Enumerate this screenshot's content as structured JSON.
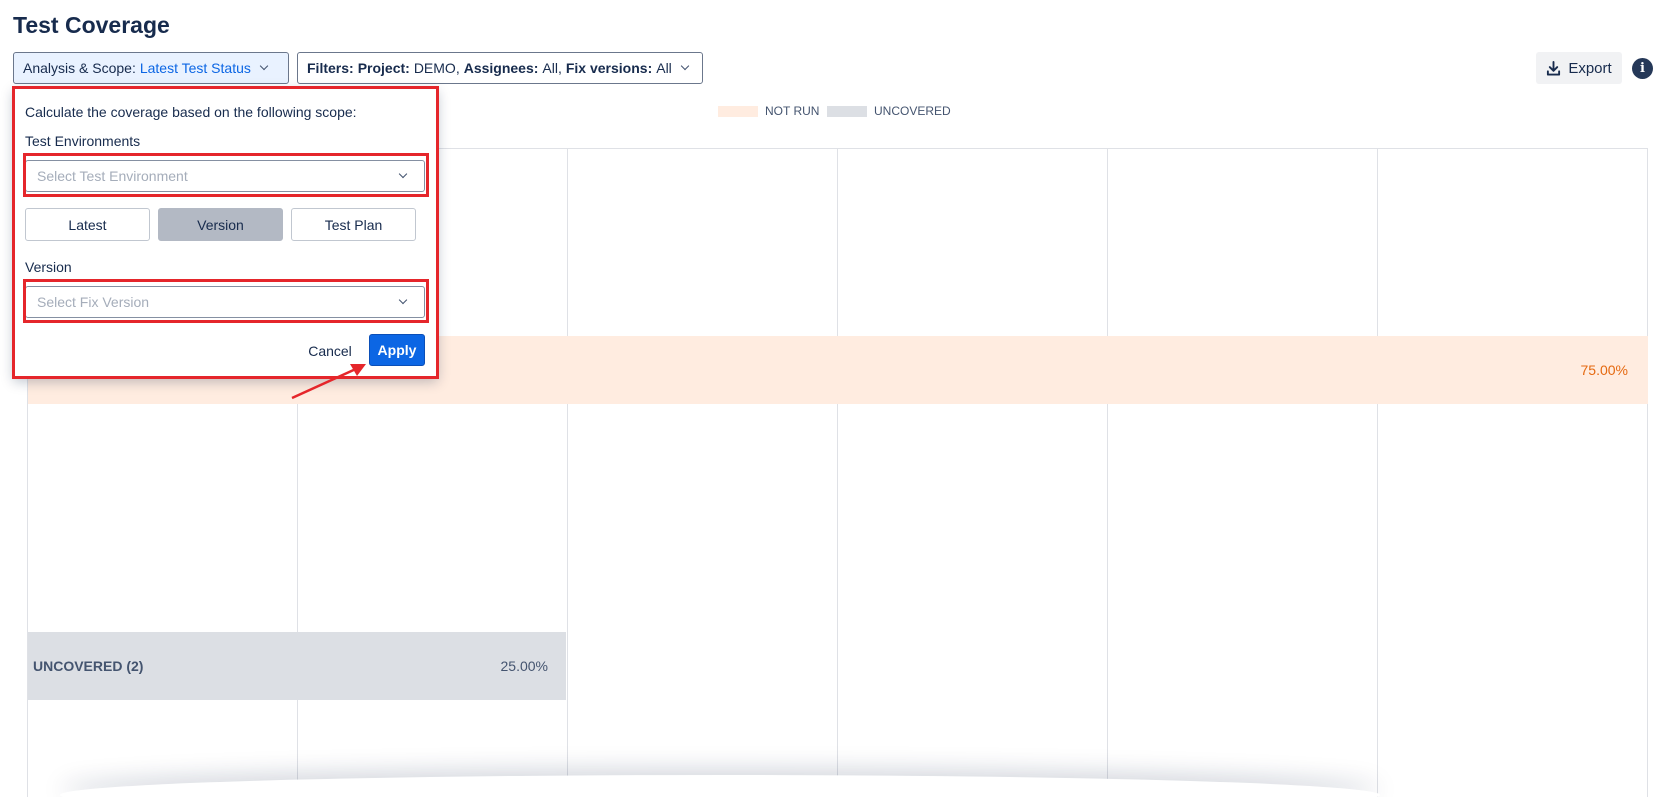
{
  "page": {
    "title": "Test Coverage"
  },
  "toolbar": {
    "scope_label": "Analysis & Scope:",
    "scope_value": "Latest Test Status",
    "filters_label": "Filters:",
    "filters_project_label": "Project:",
    "filters_project_value": "DEMO,",
    "filters_assignees_label": "Assignees:",
    "filters_assignees_value": "All,",
    "filters_fixversions_label": "Fix versions:",
    "filters_fixversions_value": "All",
    "export_label": "Export",
    "info_glyph": "i"
  },
  "legend": [
    {
      "label": "NOT RUN",
      "color": "#ffece0"
    },
    {
      "label": "UNCOVERED",
      "color": "#dcdfe4"
    }
  ],
  "chart_data": {
    "type": "bar",
    "orientation": "horizontal",
    "categories": [
      "NOT RUN",
      "UNCOVERED (2)"
    ],
    "series": [
      {
        "values": [
          75.0,
          25.0
        ]
      }
    ],
    "data_labels": [
      "75.00%",
      "25.00%"
    ],
    "category_labels": {
      "uncovered": "UNCOVERED (2)"
    },
    "colors": {
      "not_run": "#ffece0",
      "uncovered": "#dcdfe4",
      "not_run_text": "#e56910"
    },
    "grid": true
  },
  "popup": {
    "description": "Calculate the coverage based on the following scope:",
    "test_env_label": "Test Environments",
    "test_env_placeholder": "Select Test Environment",
    "scope_options": [
      "Latest",
      "Version",
      "Test Plan"
    ],
    "selected_scope": "Version",
    "version_label": "Version",
    "version_placeholder": "Select Fix Version",
    "cancel_label": "Cancel",
    "apply_label": "Apply"
  },
  "annotations": {
    "highlight_color": "#e5262b"
  }
}
